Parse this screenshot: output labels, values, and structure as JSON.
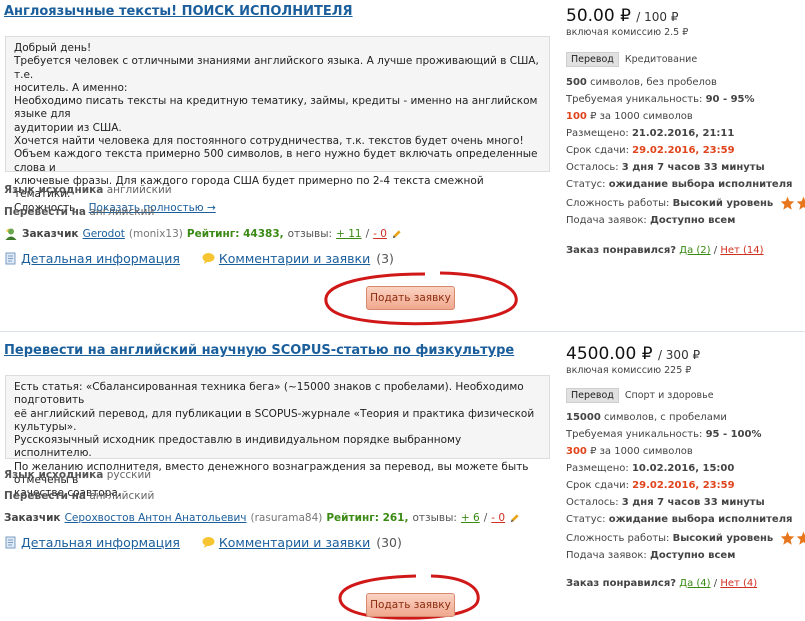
{
  "jobs": [
    {
      "title": "Англоязычные тексты! ПОИСК ИСПОЛНИТЕЛЯ",
      "description_lines": [
        "Добрый день!",
        "Требуется человек с отличными знаниями английского языка. А лучше проживающий в США, т.е.",
        "носитель. А именно:",
        "Необходимо писать тексты на кредитную тематику, займы, кредиты - именно на английском языке для",
        "аудитории из США.",
        "Хочется найти человека для постоянного сотрудничества, т.к. текстов будет очень много!",
        "Объем каждого текста примерно 500 символов, в него нужно будет включать определенные слова и",
        "ключевые фразы. Для каждого города США будет примерно по 2-4 текста смежной тематики.",
        "Сложность..."
      ],
      "show_more": "Показать полностью →",
      "source_lang_label": "Язык исходника",
      "source_lang": "английский",
      "target_lang_label": "Перевести на",
      "target_lang": "английский",
      "client_label": "Заказчик",
      "client_name": "Gerodot",
      "client_login": "(monix13)",
      "rating_label": "Рейтинг: 44383,",
      "reviews_label": "отзывы:",
      "reviews_pos": "+ 11",
      "reviews_sep": "/",
      "reviews_neg": "- 0",
      "details_link": "Детальная информация",
      "comments_link": "Комментарии и заявки",
      "comments_count": "(3)",
      "apply_label": "Подать заявку",
      "price": "50.00 ₽",
      "price_per": "/ 100 ₽",
      "commission": "включая комиссию 2.5 ₽",
      "category_badge": "Перевод",
      "category_name": "Кредитование",
      "volume": "500 символов, без пробелов",
      "volume_bold": "500",
      "volume_rest": "символов, без пробелов",
      "uniq_label": "Требуемая уникальность:",
      "uniq_value": "90 - 95%",
      "rate_value": "100",
      "rate_rest": "₽ за 1000 символов",
      "posted_label": "Размещено:",
      "posted_value": "21.02.2016, 21:11",
      "deadline_label": "Срок сдачи:",
      "deadline_value": "29.02.2016, 23:59",
      "left_label": "Осталось:",
      "left_value": "3 дня 7 часов 33 минуты",
      "status_label": "Статус:",
      "status_value": "ожидание выбора исполнителя",
      "difficulty_label": "Сложность работы:",
      "difficulty_value": "Высокий уровень",
      "submission_label": "Подача заявок:",
      "submission_value": "Доступно всем",
      "liked_label": "Заказ понравился?",
      "liked_yes": "Да (2)",
      "liked_sep": "/",
      "liked_no": "Нет (14)"
    },
    {
      "title": "Перевести на английский научную SCOPUS-статью по физкультуре",
      "description_lines": [
        "Есть статья: «Сбалансированная техника бега» (~15000 знаков с пробелами). Необходимо подготовить",
        "её английский перевод, для публикации в SCOPUS-журнале «Теория и практика физической культуры».",
        "Русскоязычный исходник предоставлю в индивидуальном порядке выбранному исполнителю.",
        "По желанию исполнителя, вместо денежного вознаграждения за перевод, вы можете быть отмечены в",
        "качестве соавтора."
      ],
      "source_lang_label": "Язык исходника",
      "source_lang": "русский",
      "target_lang_label": "Перевести на",
      "target_lang": "английский",
      "client_label": "Заказчик",
      "client_name": "Серохвостов Антон Анатольевич",
      "client_login": "(rasurama84)",
      "rating_label": "Рейтинг: 261,",
      "reviews_label": "отзывы:",
      "reviews_pos": "+ 6",
      "reviews_sep": "/",
      "reviews_neg": "- 0",
      "details_link": "Детальная информация",
      "comments_link": "Комментарии и заявки",
      "comments_count": "(30)",
      "apply_label": "Подать заявку",
      "price": "4500.00 ₽",
      "price_per": "/ 300 ₽",
      "commission": "включая комиссию 225 ₽",
      "category_badge": "Перевод",
      "category_name": "Спорт и здоровье",
      "volume_bold": "15000",
      "volume_rest": "символов, с пробелами",
      "uniq_label": "Требуемая уникальность:",
      "uniq_value": "95 - 100%",
      "rate_value": "300",
      "rate_rest": "₽ за 1000 символов",
      "posted_label": "Размещено:",
      "posted_value": "10.02.2016, 15:00",
      "deadline_label": "Срок сдачи:",
      "deadline_value": "29.02.2016, 23:59",
      "left_label": "Осталось:",
      "left_value": "3 дня 7 часов 33 минуты",
      "status_label": "Статус:",
      "status_value": "ожидание выбора исполнителя",
      "difficulty_label": "Сложность работы:",
      "difficulty_value": "Высокий уровень",
      "submission_label": "Подача заявок:",
      "submission_value": "Доступно всем",
      "liked_label": "Заказ понравился?",
      "liked_yes": "Да (4)",
      "liked_sep": "/",
      "liked_no": "Нет (4)"
    }
  ],
  "colors": {
    "link": "#1a5e9c",
    "accent_red": "#e0441c",
    "positive": "#3a8a14",
    "star": "#e8761c",
    "circle": "#d01818"
  },
  "icons": {
    "details": "document-icon",
    "comments": "speech-bubble-icon",
    "client": "person-icon",
    "edit": "pencil-icon",
    "difficulty": "star-icon"
  }
}
